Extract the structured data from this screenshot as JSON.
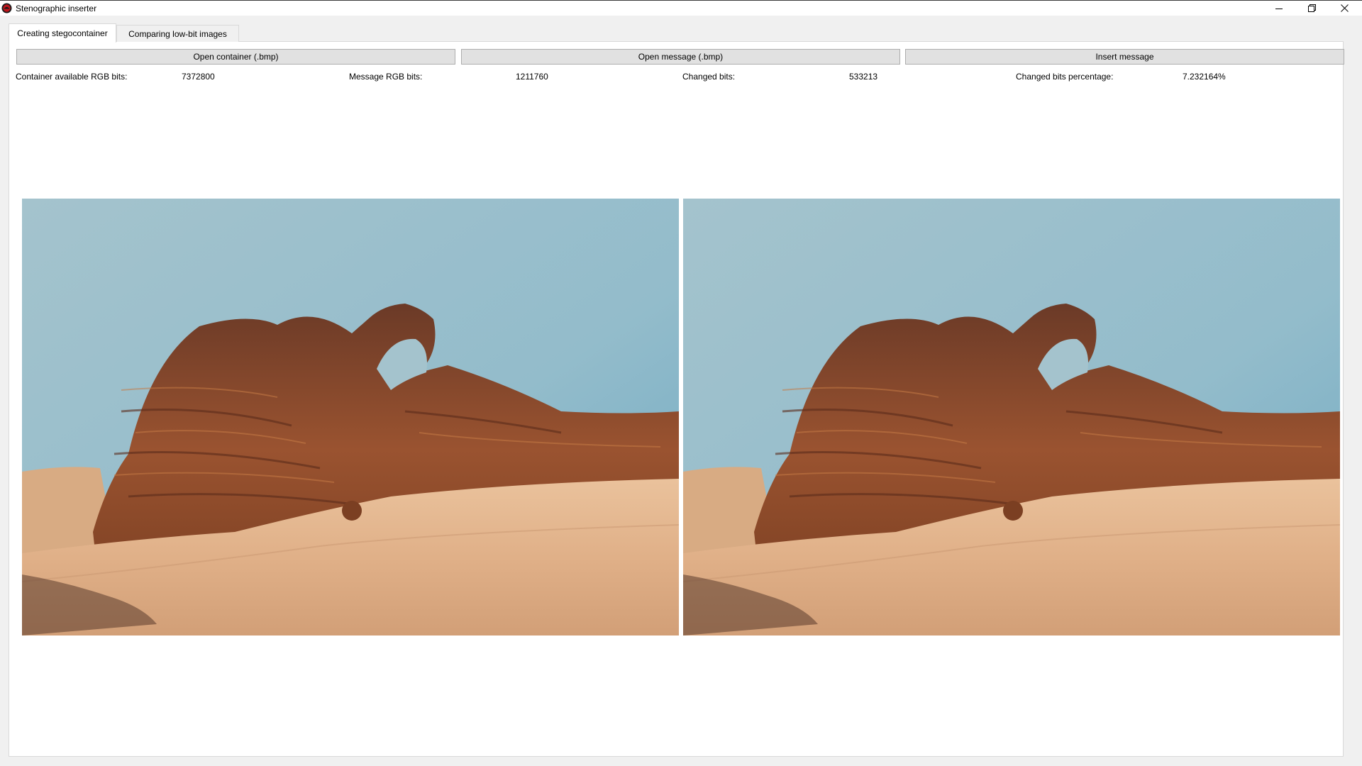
{
  "window": {
    "title": "Stenographic inserter"
  },
  "tabs": [
    {
      "label": "Creating stegocontainer",
      "active": true
    },
    {
      "label": "Comparing low-bit images",
      "active": false
    }
  ],
  "toolbar": {
    "open_container_label": "Open container (.bmp)",
    "open_message_label": "Open message (.bmp)",
    "insert_message_label": "Insert message"
  },
  "stats": {
    "container_bits_label": "Container available RGB bits:",
    "container_bits_value": "7372800",
    "message_bits_label": "Message RGB bits:",
    "message_bits_value": "1211760",
    "changed_bits_label": "Changed bits:",
    "changed_bits_value": "533213",
    "changed_pct_label": "Changed bits percentage:",
    "changed_pct_value": "7.232164%"
  },
  "images": {
    "container_preview": "desert-arch-photo",
    "stego_preview": "desert-arch-photo"
  },
  "colors": {
    "sky_top": "#9fbfcb",
    "sky_right": "#7fb2c6",
    "rock": "#8a4a2a",
    "sand": "#e2b58c",
    "app_icon": "#c0151b"
  }
}
